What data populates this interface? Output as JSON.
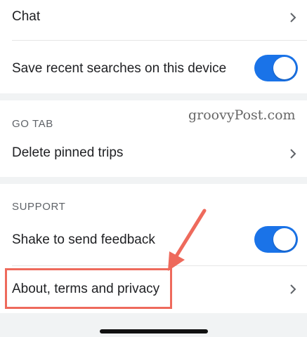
{
  "rows": {
    "chat": {
      "label": "Chat"
    },
    "save_searches": {
      "label": "Save recent searches on this device",
      "toggle_on": true
    },
    "delete_trips": {
      "label": "Delete pinned trips"
    },
    "shake_feedback": {
      "label": "Shake to send feedback",
      "toggle_on": true
    },
    "about": {
      "label": "About, terms and privacy"
    }
  },
  "sections": {
    "go_tab": {
      "header": "GO TAB"
    },
    "support": {
      "header": "SUPPORT"
    }
  },
  "watermark": "groovyPost.com",
  "colors": {
    "accent": "#1a73e8",
    "annotation": "#ee6a5c",
    "section_bg": "#f1f3f4"
  }
}
